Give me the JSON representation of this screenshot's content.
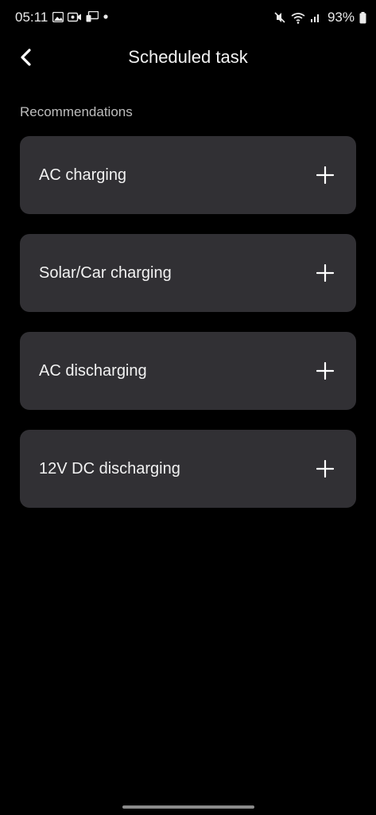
{
  "status_bar": {
    "time": "05:11",
    "battery": "93%",
    "left_icons": [
      "gallery-icon",
      "video-call-icon",
      "screen-cast-icon",
      "notification-dot-icon"
    ],
    "right_icons": [
      "mute-icon",
      "wifi-icon",
      "signal-icon",
      "battery-icon"
    ]
  },
  "header": {
    "title": "Scheduled task",
    "back_icon": "chevron-left-icon"
  },
  "recommendations": {
    "label": "Recommendations",
    "items": [
      {
        "label": "AC charging",
        "icon": "plus-icon"
      },
      {
        "label": "Solar/Car charging",
        "icon": "plus-icon"
      },
      {
        "label": "AC discharging",
        "icon": "plus-icon"
      },
      {
        "label": "12V DC discharging",
        "icon": "plus-icon"
      }
    ]
  },
  "colors": {
    "background": "#000000",
    "card": "#313034",
    "text": "#f2f2f2",
    "muted_text": "#bdbdbd"
  }
}
